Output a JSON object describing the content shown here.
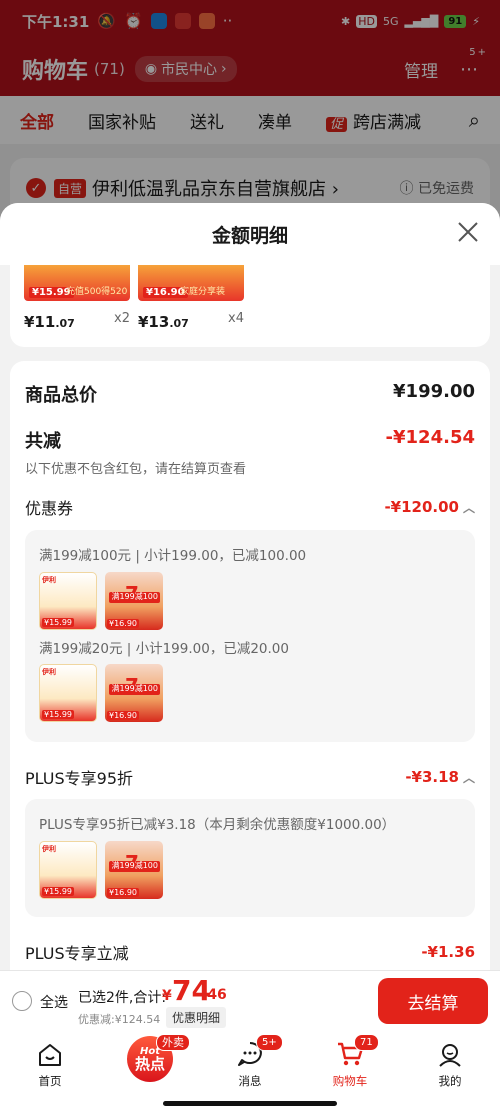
{
  "status_bar": {
    "time": "下午1:31",
    "network": "5G",
    "battery": "91"
  },
  "cart_header": {
    "title": "购物车",
    "count": "(71)",
    "location": "市民中心",
    "manage": "管理",
    "more_badge": "5+"
  },
  "tabs": [
    {
      "label": "全部",
      "active": true
    },
    {
      "label": "国家补贴"
    },
    {
      "label": "送礼"
    },
    {
      "label": "凑单"
    },
    {
      "label": "跨店满减",
      "promo_tag": "促"
    }
  ],
  "store": {
    "self_tag": "自营",
    "name": "伊利低温乳品京东自营旗舰店 ›",
    "free_shipping": "ⓘ 已免运费"
  },
  "sheet": {
    "title": "金额明细",
    "goods": [
      {
        "thumb_price": "¥15.99",
        "thumb_desc": "充值500得520",
        "price_int": "¥11",
        "price_dec": ".07",
        "qty": "x2"
      },
      {
        "thumb_price": "¥16.90",
        "thumb_desc": "家庭分享装",
        "price_int": "¥13",
        "price_dec": ".07",
        "qty": "x4"
      }
    ],
    "total_label": "商品总价",
    "total_value": "¥199.00",
    "reduce_label": "共减",
    "reduce_value": "-¥124.54",
    "reduce_note": "以下优惠不包含红包，请在结算页查看",
    "coupon": {
      "label": "优惠券",
      "amount": "-¥120.00",
      "lines": [
        "满199减100元 | 小计199.00，已减100.00",
        "满199减20元 | 小计199.00，已减20.00"
      ]
    },
    "plus95": {
      "label": "PLUS专享95折",
      "amount": "-¥3.18",
      "line": "PLUS专享95折已减¥3.18（本月剩余优惠额度¥1000.00）"
    },
    "plus_reduce": {
      "label": "PLUS专享立减",
      "amount": "-¥1.36"
    }
  },
  "thumbs": {
    "milk1_price": "¥15.99",
    "milk1_logo": "伊利",
    "milk2_num": "7",
    "milk2_tag": "满199减100",
    "milk2_price": "¥16.90"
  },
  "checkout": {
    "select_all": "全选",
    "selected": "已选2件,合计:",
    "yen": "¥",
    "amount_int": "74",
    "amount_dec": ".46",
    "discount": "优惠减:¥124.54",
    "detail_button": "优惠明细",
    "go_button": "去结算"
  },
  "tabbar": [
    {
      "label": "首页",
      "icon": "home-icon"
    },
    {
      "label": "热点",
      "icon": "hot-icon",
      "badge": "外卖",
      "hot_en": "Hot"
    },
    {
      "label": "消息",
      "icon": "message-icon",
      "badge": "5+"
    },
    {
      "label": "购物车",
      "icon": "cart-icon",
      "badge": "71",
      "active": true
    },
    {
      "label": "我的",
      "icon": "profile-icon"
    }
  ],
  "colors": {
    "brand_red": "#e2231a",
    "header_red": "#b3121b"
  }
}
